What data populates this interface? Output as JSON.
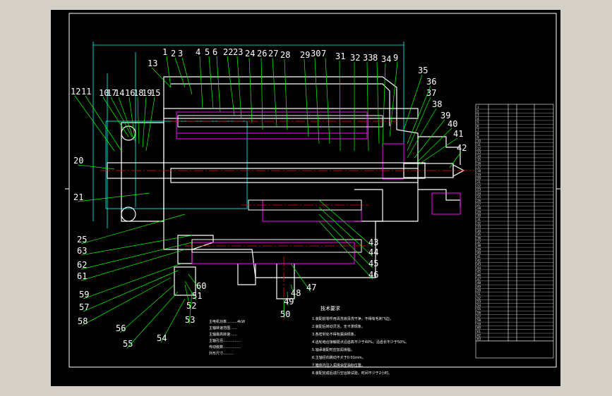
{
  "title_block_visible": true,
  "colors": {
    "background": "#d4d0c8",
    "sheet": "#000000",
    "frame": "#ffffff",
    "leader": "#00ff00",
    "geometry": "#ffffff",
    "centerline": "#ff0000",
    "section": "#ff00ff",
    "dimension": "#00ffff"
  },
  "part_numbers": [
    "1",
    "2",
    "3",
    "4",
    "5",
    "6",
    "22",
    "23",
    "24",
    "26",
    "27",
    "28",
    "29",
    "30",
    "7",
    "31",
    "32",
    "33",
    "8",
    "34",
    "9",
    "13",
    "35",
    "36",
    "37",
    "38",
    "39",
    "40",
    "41",
    "42",
    "12",
    "11",
    "10",
    "17",
    "14",
    "16",
    "18",
    "19",
    "15",
    "20",
    "21",
    "25",
    "63",
    "62",
    "61",
    "59",
    "57",
    "58",
    "56",
    "55",
    "54",
    "53",
    "52",
    "51",
    "60",
    "50",
    "49",
    "48",
    "47",
    "46",
    "45",
    "44",
    "43"
  ],
  "notes_heading": "技术要求",
  "notes": [
    "1.装配前零件用清洗液清洗干净，不得有毛刺飞边。",
    "2.装配后转动灵活，无卡滞现象。",
    "3.各密封处不得有漏油现象。",
    "4.齿轮啮合接触斑点沿齿高不少于40%，沿齿长不少于50%。",
    "5.轴承装配时应加润滑脂。",
    "6.主轴径向跳动不大于0.01mm。",
    "7.箱体内注入润滑油至油标位置。",
    "8.装配完成后进行空运转试验，时间不少于2小时。"
  ],
  "spec_lines": [
    "主电机功率………4kW",
    "主轴转速范围……",
    "主轴最高转速……",
    "主轴孔径……………",
    "传动级数……………",
    "外形尺寸………"
  ],
  "title_block_rows": [
    "1",
    "2",
    "3",
    "4",
    "5",
    "6",
    "7",
    "8",
    "9",
    "10",
    "11",
    "12",
    "13",
    "14",
    "15",
    "16",
    "17",
    "18",
    "19",
    "20",
    "21",
    "22",
    "23",
    "24",
    "25",
    "26",
    "27",
    "28",
    "29",
    "30",
    "31",
    "32",
    "33",
    "34",
    "35",
    "36",
    "37",
    "38",
    "39",
    "40",
    "41",
    "42",
    "43",
    "44",
    "45",
    "46",
    "47",
    "48",
    "49",
    "50",
    "51",
    "52",
    "53",
    "54",
    "55",
    "56",
    "57",
    "58",
    "59",
    "60",
    "61",
    "62",
    "63"
  ]
}
